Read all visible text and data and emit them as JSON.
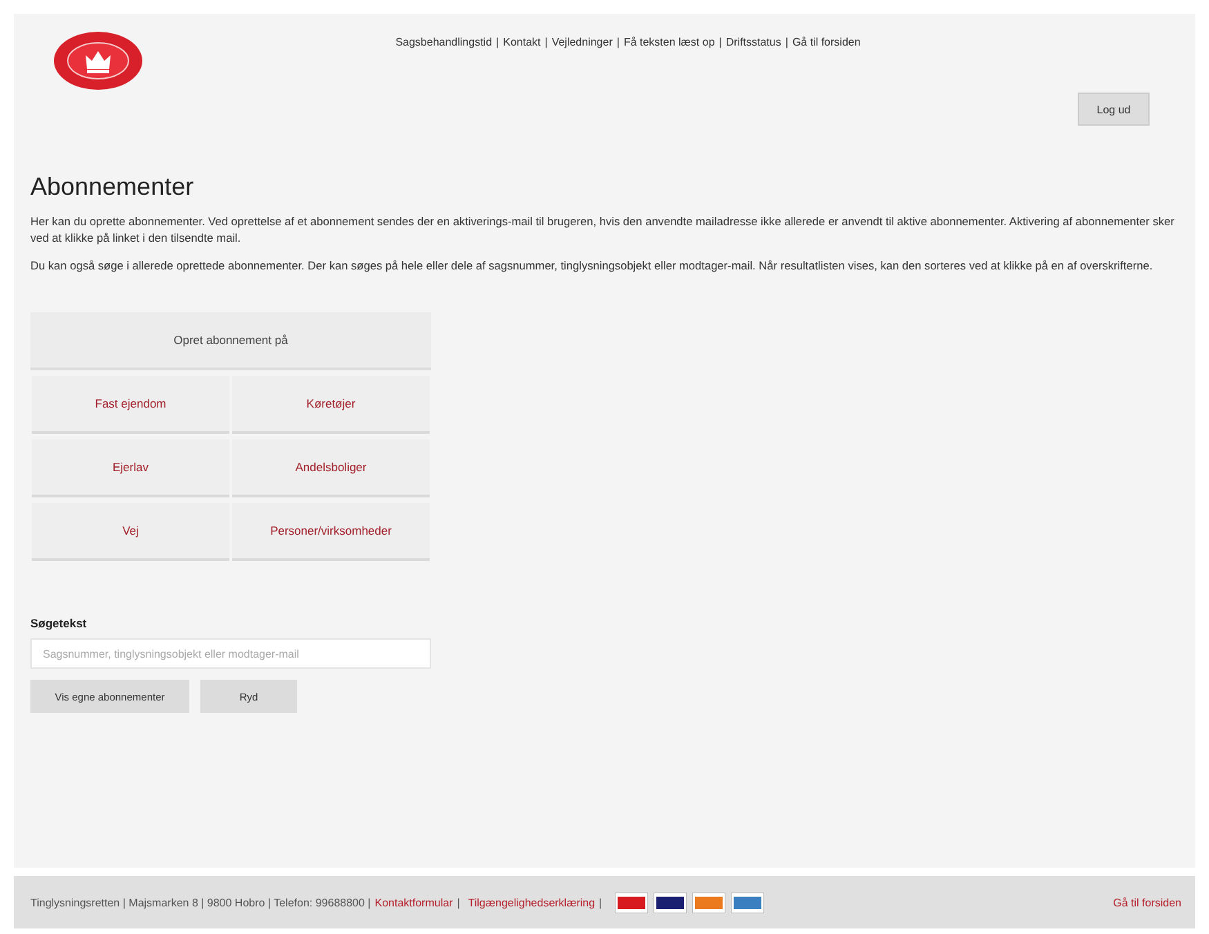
{
  "header": {
    "separator": "|",
    "nav_links": [
      "Sagsbehandlingstid",
      "Kontakt",
      "Vejledninger",
      "Få teksten læst op",
      "Driftsstatus",
      "Gå til forsiden"
    ],
    "logout_button": "Log ud"
  },
  "page": {
    "title": "Abonnementer",
    "paragraphs": [
      "Her kan du oprette abonnementer. Ved oprettelse af et abonnement sendes der en aktiverings-mail til brugeren, hvis den anvendte mailadresse ikke allerede er anvendt til aktive abonnementer. Aktivering af abonnementer sker ved at klikke på linket i den tilsendte mail.",
      "Du kan også søge i allerede oprettede abonnementer. Der kan søges på hele eller dele af sagsnummer, tinglysningsobjekt eller modtager-mail. Når resultatlisten vises, kan den sorteres ved at klikke på en af overskrifterne."
    ]
  },
  "create_panel": {
    "heading": "Opret abonnement på",
    "options": [
      "Fast ejendom",
      "Køretøjer",
      "Ejerlav",
      "Andelsboliger",
      "Vej",
      "Personer/virksomheder"
    ]
  },
  "search": {
    "label": "Søgetekst",
    "placeholder": "Sagsnummer, tinglysningsobjekt eller modtager-mail",
    "buttons": [
      "Vis egne abonnementer",
      "Ryd"
    ]
  },
  "footer": {
    "separator": "|",
    "info": "Tinglysningsretten | Majsmarken 8 | 9800 Hobro | Telefon: 99688800 |",
    "links": [
      "Kontaktformular",
      "Tilgængelighedserklæring"
    ],
    "payment_cards": [
      {
        "color": "#d71920"
      },
      {
        "color": "#1a1f71"
      },
      {
        "color": "#eb7a1f"
      },
      {
        "color": "#3a7fc0"
      }
    ],
    "home_link": "Gå til forsiden"
  }
}
